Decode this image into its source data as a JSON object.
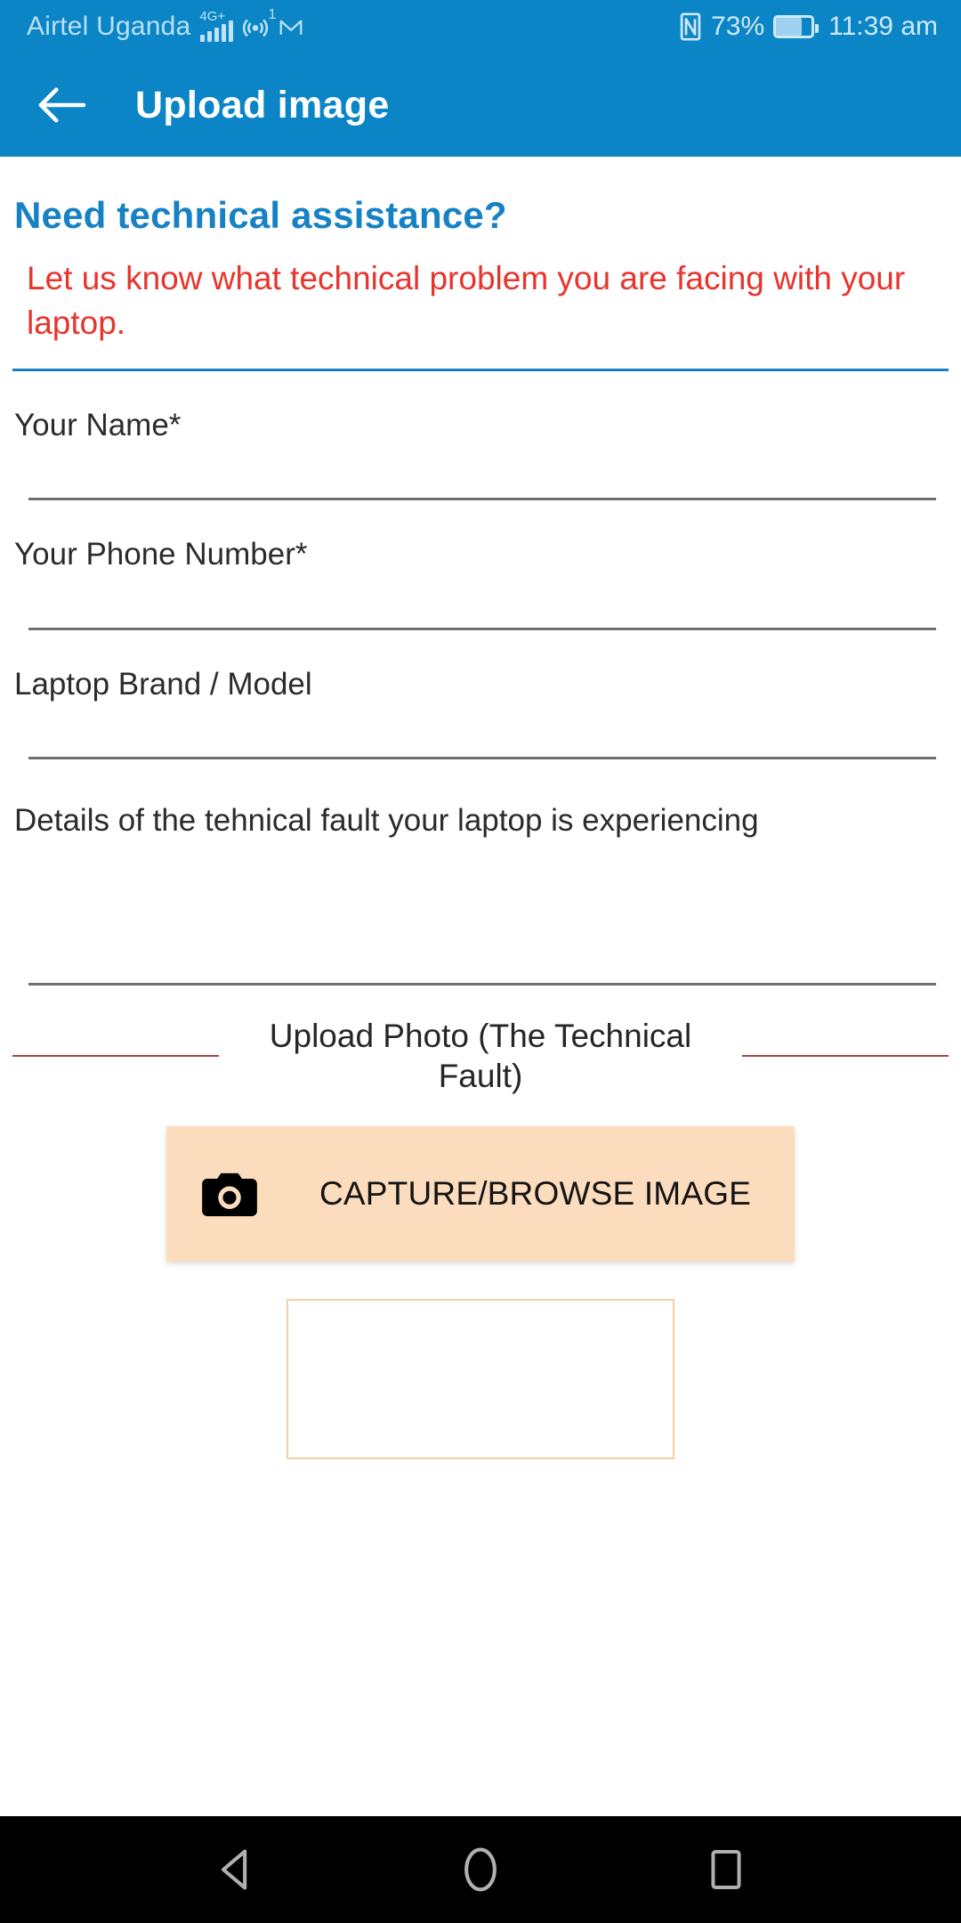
{
  "status_bar": {
    "carrier": "Airtel Uganda",
    "network_type": "4G+",
    "hotspot_badge": "1",
    "battery_percent": "73%",
    "battery_level": 73,
    "time": "11:39 am",
    "icons": [
      "signal-bars-icon",
      "hotspot-icon",
      "mail-icon",
      "nfc-icon",
      "battery-icon"
    ],
    "colors": {
      "background": "#0b85c6",
      "text": "#cfe9f7"
    }
  },
  "app_bar": {
    "back_label": "back-arrow",
    "title": "Upload image",
    "color": "#0b85c6"
  },
  "content": {
    "headline": "Need technical assistance?",
    "subhead": "Let us know what technical problem you are facing with your laptop.",
    "headline_color": "#1681c4",
    "subhead_color": "#e8342c",
    "fields": [
      {
        "label": "Your Name*",
        "value": "",
        "placeholder": ""
      },
      {
        "label": "Your Phone Number*",
        "value": "",
        "placeholder": ""
      },
      {
        "label": "Laptop Brand / Model",
        "value": "",
        "placeholder": ""
      },
      {
        "label": "Details of the tehnical fault your laptop is experiencing",
        "value": "",
        "placeholder": ""
      }
    ],
    "upload_section": {
      "title": "Upload Photo (The Technical Fault)",
      "rule_color": "#9b4a4a",
      "capture_button": {
        "label": "CAPTURE/BROWSE IMAGE",
        "icon": "camera-icon",
        "background": "#fbdcbc",
        "text_color": "#141414"
      },
      "preview": {
        "border_color": "#f2cfa8",
        "content": ""
      }
    }
  },
  "nav_bar": {
    "background": "#000000",
    "buttons": [
      {
        "name": "back",
        "icon": "triangle-back-icon"
      },
      {
        "name": "home",
        "icon": "circle-home-icon"
      },
      {
        "name": "recents",
        "icon": "square-recents-icon"
      }
    ]
  }
}
